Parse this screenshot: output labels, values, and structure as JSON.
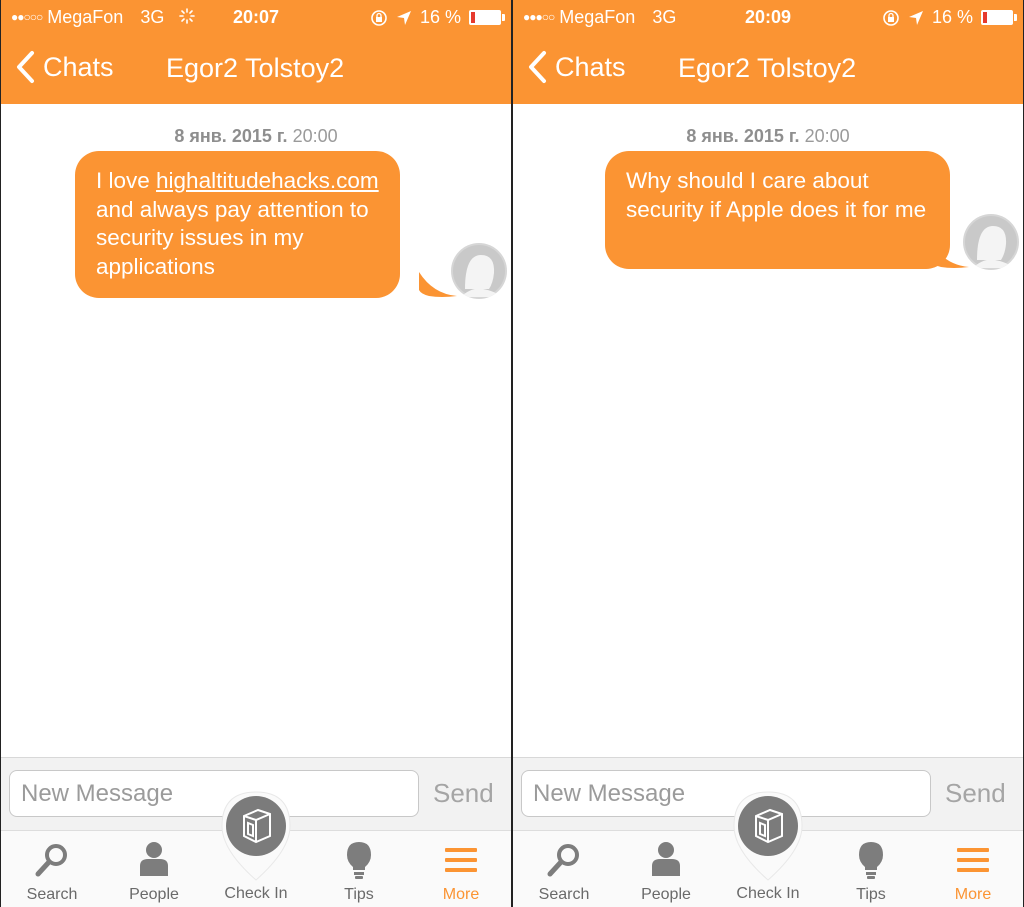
{
  "screens": [
    {
      "status_bar": {
        "signal": "●●○○○",
        "carrier": "MegaFon",
        "network": "3G",
        "time": "20:07",
        "battery": "16 %",
        "battery_level": 0.16
      },
      "nav": {
        "back_label": "Chats",
        "title": "Egor2 Tolstoy2"
      },
      "date_bold": "8 янв. 2015 г.",
      "date_time": "20:00",
      "message": {
        "before_link": "I love ",
        "link": "highaltitudehacks.com",
        "after_link": " and always pay attention to security issues in my applications"
      },
      "input_placeholder": "New Message",
      "send_label": "Send",
      "tabs": {
        "search": "Search",
        "people": "People",
        "checkin": "Check In",
        "tips": "Tips",
        "more": "More"
      }
    },
    {
      "status_bar": {
        "signal": "●●●○○",
        "carrier": "MegaFon",
        "network": "3G",
        "time": "20:09",
        "battery": "16 %",
        "battery_level": 0.16
      },
      "nav": {
        "back_label": "Chats",
        "title": "Egor2 Tolstoy2"
      },
      "date_bold": "8 янв. 2015 г.",
      "date_time": "20:00",
      "message": {
        "text": "Why should I care about security if Apple does it for me"
      },
      "input_placeholder": "New Message",
      "send_label": "Send",
      "tabs": {
        "search": "Search",
        "people": "People",
        "checkin": "Check In",
        "tips": "Tips",
        "more": "More"
      }
    }
  ],
  "colors": {
    "accent": "#fb9433",
    "battery_low": "#e63a2e",
    "tab_inactive": "#6a6a6a",
    "date_gray": "#9a9a9a"
  },
  "icons": [
    "chevron-left-icon",
    "search-icon",
    "people-icon",
    "check-in-icon",
    "tips-icon",
    "more-icon",
    "avatar-icon",
    "orientation-lock-icon",
    "location-arrow-icon",
    "battery-icon",
    "activity-spinner-icon"
  ]
}
